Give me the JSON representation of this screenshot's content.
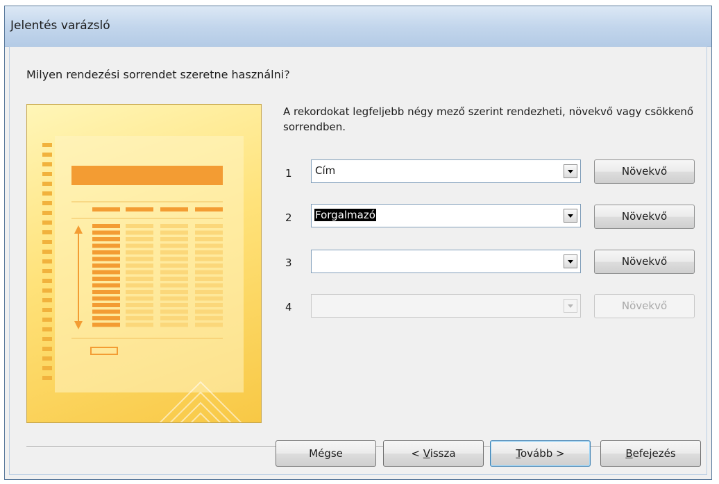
{
  "window": {
    "title": "Jelentés varázsló"
  },
  "question": "Milyen rendezési sorrendet szeretne használni?",
  "info_text": "A rekordokat legfeljebb négy mező szerint rendezheti, növekvő vagy csökkenő sorrendben.",
  "sort_rows": [
    {
      "number": "1",
      "field": "Cím",
      "order": "Növekvő",
      "enabled": true,
      "selected": false
    },
    {
      "number": "2",
      "field": "Forgalmazó",
      "order": "Növekvő",
      "enabled": true,
      "selected": true
    },
    {
      "number": "3",
      "field": "",
      "order": "Növekvő",
      "enabled": true,
      "selected": false
    },
    {
      "number": "4",
      "field": "",
      "order": "Növekvő",
      "enabled": false,
      "selected": false
    }
  ],
  "footer": {
    "cancel": "Mégse",
    "back": {
      "prefix": "< ",
      "accel": "V",
      "rest": "issza"
    },
    "next": {
      "accel": "T",
      "rest": "ovább >"
    },
    "finish": {
      "accel": "B",
      "rest": "efejezés"
    }
  },
  "colors": {
    "illustration_bg": "#ffe27a",
    "illustration_accent": "#f39c33",
    "title_gradient_top": "#dce8f5"
  },
  "icons": {
    "dropdown": "chevron-down-icon",
    "illustration": "report-preview-illustration"
  }
}
